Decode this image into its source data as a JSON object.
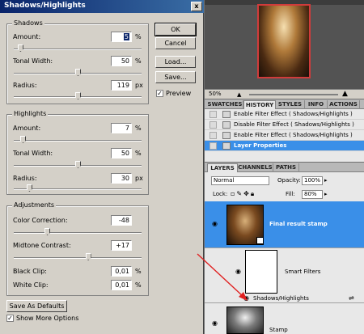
{
  "dialog": {
    "title": "Shadows/Highlights",
    "close_glyph": "x",
    "shadows": {
      "label": "Shadows",
      "amount": {
        "label": "Amount:",
        "value": "5",
        "unit": "%",
        "level": 0.05
      },
      "tonal_width": {
        "label": "Tonal Width:",
        "value": "50",
        "unit": "%",
        "level": 0.5
      },
      "radius": {
        "label": "Radius:",
        "value": "119",
        "unit": "px",
        "level": 0.5
      }
    },
    "highlights": {
      "label": "Highlights",
      "amount": {
        "label": "Amount:",
        "value": "7",
        "unit": "%",
        "level": 0.07
      },
      "tonal_width": {
        "label": "Tonal Width:",
        "value": "50",
        "unit": "%",
        "level": 0.5
      },
      "radius": {
        "label": "Radius:",
        "value": "30",
        "unit": "px",
        "level": 0.12
      }
    },
    "adjustments": {
      "label": "Adjustments",
      "color_correction": {
        "label": "Color Correction:",
        "value": "-48",
        "unit": "",
        "level": 0.26
      },
      "midtone_contrast": {
        "label": "Midtone Contrast:",
        "value": "+17",
        "unit": "",
        "level": 0.58
      },
      "black_clip": {
        "label": "Black Clip:",
        "value": "0,01",
        "unit": "%"
      },
      "white_clip": {
        "label": "White Clip:",
        "value": "0,01",
        "unit": "%"
      }
    },
    "buttons": {
      "ok": "OK",
      "cancel": "Cancel",
      "load": "Load...",
      "save": "Save...",
      "save_defaults": "Save As Defaults"
    },
    "preview": {
      "label": "Preview",
      "checked": true
    },
    "show_more": {
      "label": "Show More Options",
      "checked": true
    }
  },
  "navigator": {
    "zoom": "50%"
  },
  "history": {
    "tabs": [
      "SWATCHES",
      "HISTORY",
      "STYLES",
      "INFO",
      "ACTIONS"
    ],
    "active_tab": "HISTORY",
    "items": [
      {
        "label": "Enable Filter Effect ( Shadows/Highlights )"
      },
      {
        "label": "Disable Filter Effect ( Shadows/Highlights )"
      },
      {
        "label": "Enable Filter Effect ( Shadows/Highlights )"
      },
      {
        "label": "Layer Properties"
      }
    ]
  },
  "layers": {
    "tabs": [
      "LAYERS",
      "CHANNELS",
      "PATHS"
    ],
    "blend_mode": "Normal",
    "opacity_label": "Opacity:",
    "opacity": "100%",
    "lock_label": "Lock:",
    "fill_label": "Fill:",
    "fill": "80%",
    "rows": [
      {
        "name": "Final result stamp"
      },
      {
        "name": "Smart Filters"
      },
      {
        "name": "Shadows/Highlights"
      },
      {
        "name": "Stamp"
      }
    ]
  },
  "colors": {
    "accent": "#3a8fe8",
    "arrow": "#e02020"
  }
}
